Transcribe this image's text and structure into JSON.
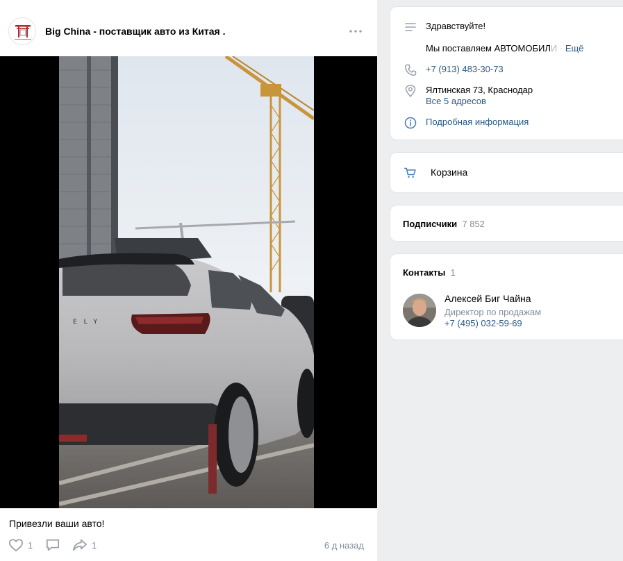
{
  "post": {
    "community_name": "Big China - поставщик авто из Китая .",
    "text": "Привезли ваши авто!",
    "likes": "1",
    "shares": "1",
    "date": "6 д назад",
    "avatar_text": "BIG CHINA"
  },
  "info": {
    "greeting": "Здравствуйте!",
    "description_prefix": "Мы поставляем АВТОМОБИЛ",
    "description_fade": "И",
    "more_label": "Ещё",
    "phone": "+7 (913) 483-30-73",
    "address": "Ялтинская 73, Краснодар",
    "all_addresses": "Все 5 адресов",
    "details_label": "Подробная информация"
  },
  "cart": {
    "label": "Корзина"
  },
  "subscribers": {
    "label": "Подписчики",
    "count": "7 852"
  },
  "contacts": {
    "label": "Контакты",
    "count": "1",
    "person": {
      "name": "Алексей Биг Чайна",
      "role": "Директор по продажам",
      "phone": "+7 (495) 032-59-69"
    }
  },
  "colors": {
    "link": "#2a5885",
    "muted": "#818c99",
    "icon": "#447bba",
    "background": "#edeef0"
  }
}
